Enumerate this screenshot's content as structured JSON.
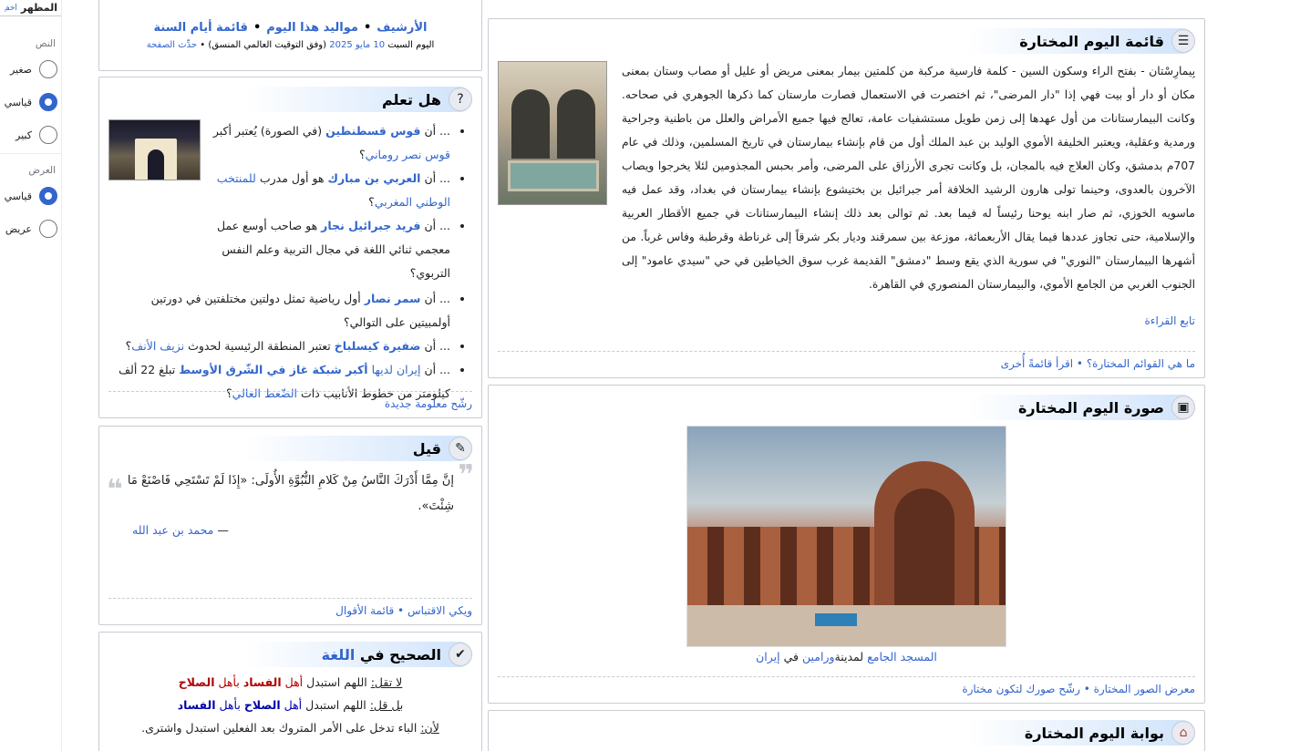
{
  "sidebar": {
    "title": "المظهر",
    "hide": "أخفِ",
    "text_section": "النص",
    "text_options": [
      {
        "label": "صغير",
        "checked": false
      },
      {
        "label": "قياسي",
        "checked": true
      },
      {
        "label": "كبير",
        "checked": false
      }
    ],
    "width_section": "العرض",
    "width_options": [
      {
        "label": "قياسي",
        "checked": true
      },
      {
        "label": "عريض",
        "checked": false
      }
    ]
  },
  "archive": {
    "archive": "الأرشيف",
    "births": "مواليد هذا اليوم",
    "days_list": "قائمة أيام السنة",
    "date_text": "اليوم السبت",
    "date_link": "10 مايو 2025",
    "utc": "(وفق التوقيت العالمي المنسق)",
    "refresh": "حدِّث الصفحة"
  },
  "dyk": {
    "title": "هل تعلم",
    "items": [
      {
        "pre": "... أن",
        "bold": "قوس قسطنطين",
        "mid": "(في الصورة) يُعتبر أكبر",
        "link": "قوس نصر روماني",
        "post": "؟"
      },
      {
        "pre": "... أن",
        "bold": "العربي بن مبارك",
        "mid": "هو أول مدرب",
        "link": "للمنتخب الوطني المغربي",
        "post": "؟"
      },
      {
        "pre": "... أن",
        "bold": "فريد جبرائيل نجار",
        "mid": "هو صاحب أوسع عمل معجمي ثنائي اللغة في مجال التربية وعلم النفس التربوي",
        "link": "",
        "post": "؟"
      },
      {
        "pre": "... أن",
        "bold": "سمر نصار",
        "mid": "أول رياضية تمثل دولتين مختلفتين في دورتين أولمبيتين على التوالي",
        "link": "",
        "post": "؟"
      },
      {
        "pre": "... أن",
        "bold": "ضفيرة كيسلباخ",
        "mid": "تعتبر المنطقة الرئيسية لحدوث",
        "link": "نزيف الأنف",
        "post": "؟"
      },
      {
        "pre": "... أن",
        "bold": "أكبر شبكة غاز في الشّرق الأوسط",
        "mid": "تبلغ 22 ألف كيلومتر من خطوط الأنابيب ذات",
        "link": "الضّغط العالي",
        "post": "؟",
        "lead_link": "إيران لديها"
      }
    ],
    "footer": "رشّح معلومة جديدة"
  },
  "quote": {
    "title": "قيل",
    "text": "إنَّ مِمَّا أَدْرَكَ النَّاسُ مِنْ كَلامِ النُّبُوَّةِ الأُولَى: «إِذَا لَمْ تَسْتَحِي فَاصْنَعْ مَا شِئْتَ».",
    "author_dash": "—",
    "author": "محمد بن عبد الله",
    "footer_a": "ويكي الاقتباس",
    "footer_b": "قائمة الأقوال"
  },
  "language": {
    "title_a": "الصحيح في",
    "title_b": "اللغة",
    "line1_label": "لا تقل:",
    "line1_text": "اللهم استبدل",
    "line1_w1": "أهل",
    "line1_w2": "الفساد",
    "line1_w3": "بأهل",
    "line1_w4": "الصلاح",
    "line2_label": "بل قل:",
    "line2_text": "اللهم استبدل",
    "line2_w1": "أهل",
    "line2_w2": "الصلاح",
    "line2_w3": "بأهل",
    "line2_w4": "الفساد",
    "line3_label": "لأن:",
    "line3_text": "الباء تدخل على الأمر المتروك بعد الفعلين استبدل واشترى."
  },
  "featured_list": {
    "title": "قائمة اليوم المختارة",
    "text": "بِيمارِسْتان - بفتح الراء وسكون السين - كلمة فارسية مركبة من كلمتين بيمار بمعنى مريض أو عليل أو مصاب وستان بمعنى مكان أو دار أو بيت فهي إذا \"دار المرضى\"، ثم اختصرت في الاستعمال فصارت مارستان كما ذكرها الجوهري في صحاحه. وكانت البيمارستانات من أول عهدها إلى زمن طويل مستشفيات عامة، تعالج فيها جميع الأمراض والعلل من باطنية وجراحية ورمدية وعقلية، ويعتبر الخليفة الأموي الوليد بن عبد الملك أول من قام بإنشاء بيمارستان في تاريخ المسلمين، وذلك في عام 707م بدمشق، وكان العلاج فيه بالمجان، بل وكانت تجرى الأرزاق على المرضى، وأمر بحبس المجذومين لئلا يخرجوا ويصاب الآخرون بالعدوى، وحينما تولى هارون الرشيد الخلافة أمر جبرائيل بن بختيشوع بإنشاء بيمارستان في بغداد، وقد عمل فيه ماسويه الخوزي، ثم صار ابنه يوحنا رئيساً له فيما بعد. ثم توالى بعد ذلك إنشاء البيمارستانات في جميع الأقطار العربية والإسلامية، حتى تجاوز عددها فيما يقال الأربعمائة، موزعة بين سمرقند وديار بكر شرقاً إلى غرناطة وقرطبة وفاس غرباً. من أشهرها البيمارستان \"النوري\" في سورية الذي يقع وسط \"دمشق\" القديمة غرب سوق الخياطين في حي \"سيدي عامود\" إلى الجنوب الغربي من الجامع الأموي، والبيمارستان المنصوري في القاهرة.",
    "more": "تابع القراءة",
    "footer_a": "ما هي القوائم المختارة؟",
    "footer_b": "اقرأ قائمةً أُخرى"
  },
  "featured_picture": {
    "title": "صورة اليوم المختارة",
    "cap_link1": "المسجد الجامع",
    "cap_mid": "لمدينة",
    "cap_link2": "ورامين",
    "cap_in": "في",
    "cap_link3": "إيران",
    "footer_a": "معرض الصور المختارة",
    "footer_b": "رشّح صورك لتكون مختارة"
  },
  "portal": {
    "title": "بوابة اليوم المختارة"
  },
  "colors": {
    "link": "#3366cc",
    "border": "#c8ccd1",
    "head_gradient": "#cfe3fb"
  }
}
